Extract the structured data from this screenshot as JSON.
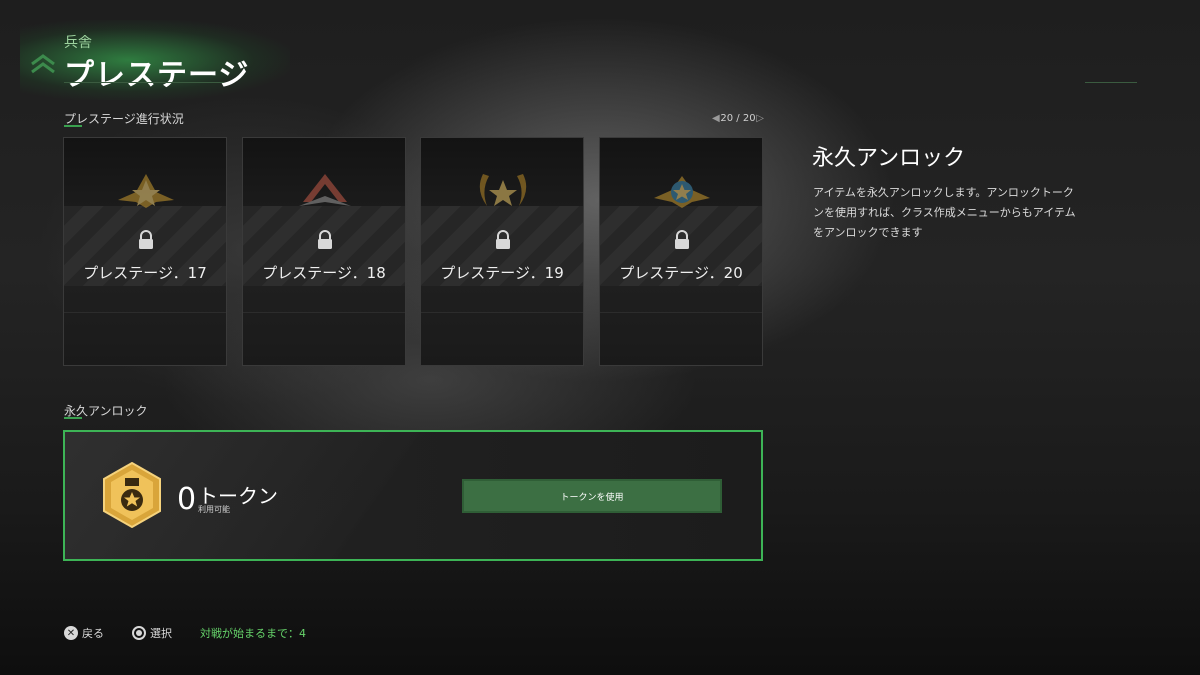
{
  "header": {
    "breadcrumb": "兵舎",
    "title": "プレステージ"
  },
  "progress": {
    "label": "プレステージ進行状況",
    "pager": "20 / 20"
  },
  "cards": [
    {
      "label": "プレステージ．17",
      "locked": true,
      "emblem": "gold-star-wings-emblem"
    },
    {
      "label": "プレステージ．18",
      "locked": true,
      "emblem": "red-chevron-emblem"
    },
    {
      "label": "プレステージ．19",
      "locked": true,
      "emblem": "gold-laurel-star-emblem"
    },
    {
      "label": "プレステージ．20",
      "locked": true,
      "emblem": "blue-gold-star-emblem"
    }
  ],
  "detail": {
    "title": "永久アンロック",
    "description": "アイテムを永久アンロックします。アンロックトークンを使用すれば、クラス作成メニューからもアイテムをアンロックできます"
  },
  "permanent_unlock": {
    "label": "永久アンロック",
    "token_count": "0",
    "token_name": "トークン",
    "available_label": "利用可能",
    "use_button": "トークンを使用"
  },
  "footer": {
    "back": "戻る",
    "select": "選択",
    "status": "対戦が始まるまで：4"
  },
  "colors": {
    "accent": "#3db456",
    "button": "#3c6f43",
    "status_text": "#66d36a"
  }
}
